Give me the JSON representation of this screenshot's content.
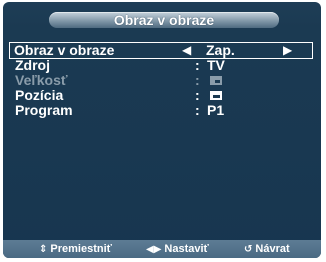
{
  "title": "Obraz v obraze",
  "menu": {
    "items": [
      {
        "label": "Obraz v obraze",
        "colon": "",
        "value": "Zap.",
        "arrow_left": "◀",
        "arrow_right": "▶"
      },
      {
        "label": "Zdroj",
        "colon": ":",
        "value": "TV"
      },
      {
        "label": "Veľkosť",
        "colon": ":"
      },
      {
        "label": "Pozícia",
        "colon": ":"
      },
      {
        "label": "Program",
        "colon": ":",
        "value": "P1"
      }
    ]
  },
  "footer": {
    "move_icon": "⇕",
    "move_label": "Premiestniť",
    "adjust_icon": "◀▶",
    "adjust_label": "Nastaviť",
    "back_icon": "↺",
    "back_label": "Návrat"
  },
  "colors": {
    "panel": "#1b3a52",
    "footer": "#4a6a83",
    "text": "#ffffff",
    "disabled_text": "#8a9caa"
  }
}
